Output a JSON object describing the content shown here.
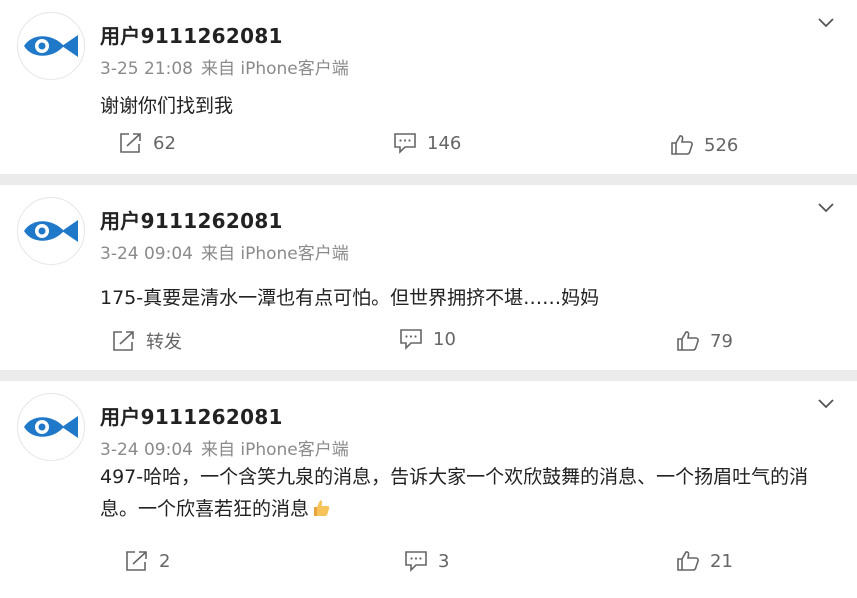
{
  "posts": [
    {
      "username": "用户9111262081",
      "time": "3-25 21:08",
      "source": "来自 iPhone客户端",
      "content": "谢谢你们找到我",
      "repost": "62",
      "comments": "146",
      "likes": "526"
    },
    {
      "username": "用户9111262081",
      "time": "3-24 09:04",
      "source": "来自 iPhone客户端",
      "content": "175-真要是清水一潭也有点可怕。但世界拥挤不堪……妈妈",
      "repost": "转发",
      "comments": "10",
      "likes": "79"
    },
    {
      "username": "用户9111262081",
      "time": "3-24 09:04",
      "source": "来自 iPhone客户端",
      "content": "497-哈哈，一个含笑九泉的消息，告诉大家一个欢欣鼓舞的消息、一个扬眉吐气的消息。一个欣喜若狂的消息",
      "repost": "2",
      "comments": "3",
      "likes": "21"
    }
  ],
  "icons": {
    "avatar": "fish-logo-icon",
    "menu": "chevron-down-icon",
    "repost": "share-icon",
    "comment": "comment-icon",
    "like": "thumbs-up-icon",
    "emoji": "thumbs-up-emoji"
  },
  "colors": {
    "fish_blue": "#1f78c8",
    "background": "#ebebeb",
    "meta_gray": "#8a8a8a"
  }
}
